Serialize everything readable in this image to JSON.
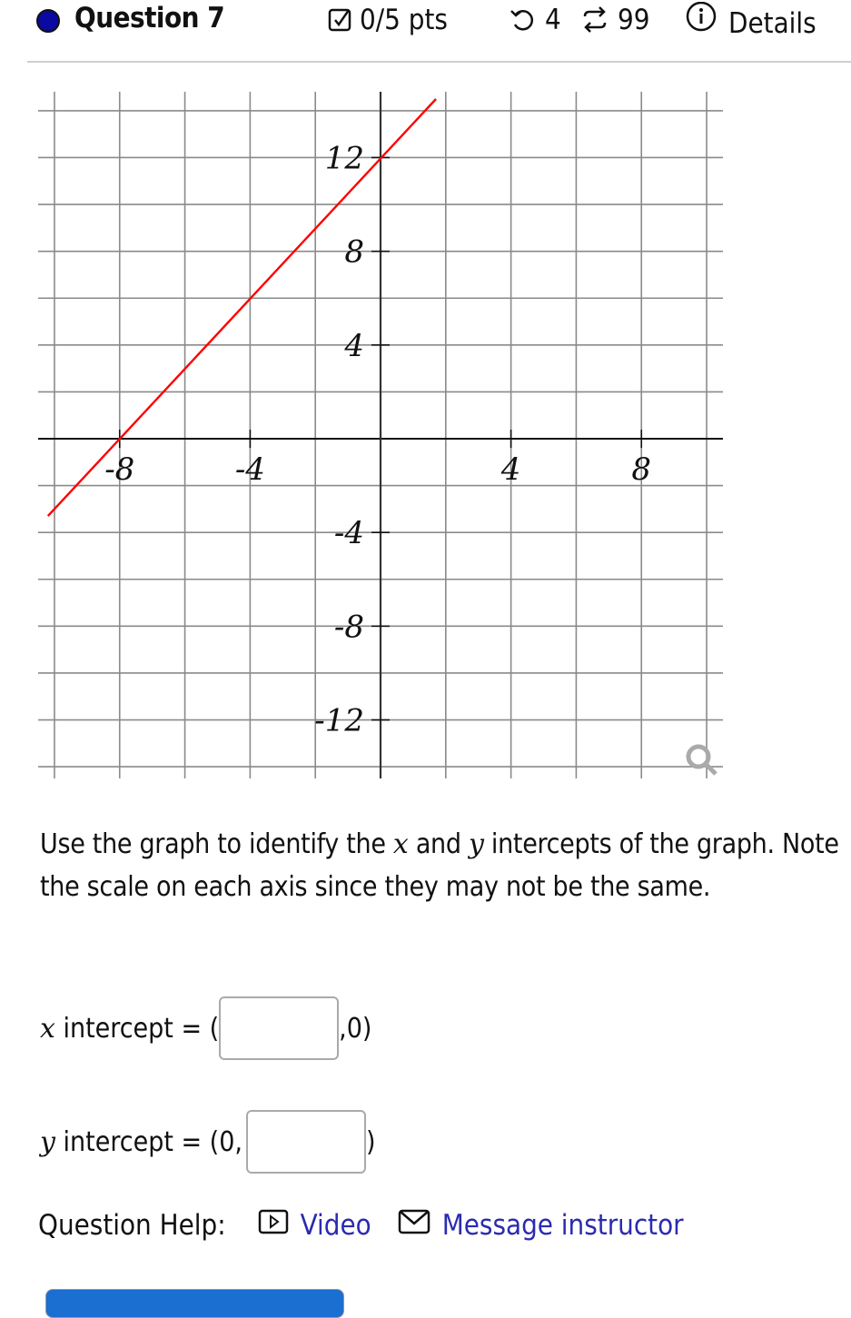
{
  "header": {
    "question_title": "Question 7",
    "points": "0/5 pts",
    "retries": "4",
    "submissions": "99",
    "details_label": "Details",
    "status_dot_color": "#0a0aa0",
    "icons": [
      "check-square-icon",
      "undo-icon",
      "repeat-icon",
      "info-icon"
    ]
  },
  "chart_data": {
    "type": "line",
    "title": "",
    "xlabel": "",
    "ylabel": "",
    "xlim": [
      -10.5,
      10.5
    ],
    "ylim": [
      -14.5,
      14.5
    ],
    "grid": true,
    "x_grid_step": 2,
    "y_grid_step": 2,
    "x_ticks": [
      -8,
      -4,
      4,
      8
    ],
    "x_tick_labels": [
      "-8",
      "-4",
      "4",
      "8"
    ],
    "y_ticks": [
      12,
      8,
      4,
      -4,
      -8,
      -12
    ],
    "y_tick_labels": [
      "12",
      "8",
      "4",
      "-4",
      "-8",
      "-12"
    ],
    "series": [
      {
        "name": "line",
        "color": "#ff0000",
        "x": [
          -10.2,
          1.7
        ],
        "y": [
          -3.3,
          14.5
        ],
        "slope": 1.5,
        "intercept": 12
      }
    ],
    "annotations": [
      "magnifier-icon"
    ]
  },
  "prompt": {
    "part1": "Use the graph to identify the ",
    "var_x": "x",
    "part2": " and ",
    "var_y": "y",
    "part3": " intercepts of the graph. Note the scale on each axis since they may not be the same."
  },
  "answers": {
    "x_row": {
      "var": "x",
      "label": " intercept = (",
      "suffix": ",0)",
      "value": "",
      "placeholder": ""
    },
    "y_row": {
      "var": "y",
      "label": " intercept = (0,",
      "suffix": ")",
      "value": "",
      "placeholder": ""
    }
  },
  "help": {
    "label": "Question Help:",
    "video_label": "Video",
    "message_label": "Message instructor",
    "link_color": "#2b2bb0"
  }
}
